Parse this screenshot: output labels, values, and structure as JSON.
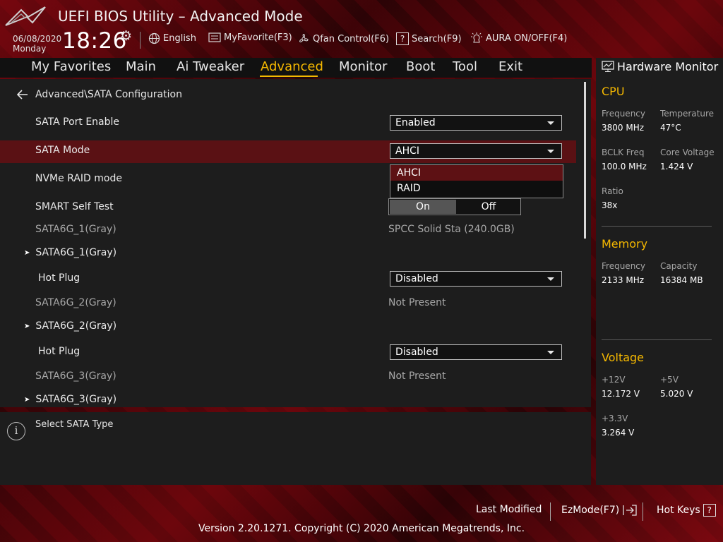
{
  "header": {
    "title": "UEFI BIOS Utility – Advanced Mode",
    "date": "06/08/2020",
    "day": "Monday",
    "time": "18:26",
    "tools": [
      {
        "label": "English",
        "icon": "globe-icon"
      },
      {
        "label": "MyFavorite(F3)",
        "icon": "favorite-list-icon"
      },
      {
        "label": "Qfan Control(F6)",
        "icon": "fan-icon"
      },
      {
        "label": "Search(F9)",
        "icon": "search-help-icon"
      },
      {
        "label": "AURA ON/OFF(F4)",
        "icon": "aura-light-icon"
      }
    ]
  },
  "nav": {
    "tabs": [
      "My Favorites",
      "Main",
      "Ai Tweaker",
      "Advanced",
      "Monitor",
      "Boot",
      "Tool",
      "Exit"
    ],
    "active": "Advanced"
  },
  "main": {
    "breadcrumb": "Advanced\\SATA Configuration",
    "rows": {
      "sata_port_enable": {
        "label": "SATA Port Enable",
        "value": "Enabled"
      },
      "sata_mode": {
        "label": "SATA Mode",
        "value": "AHCI",
        "options": [
          "AHCI",
          "RAID"
        ]
      },
      "nvme_raid": {
        "label": "NVMe RAID mode"
      },
      "smart": {
        "label": "SMART Self Test",
        "on": "On",
        "off": "Off",
        "selected": "On"
      },
      "port1_info": {
        "label": "SATA6G_1(Gray)",
        "value": "SPCC Solid Sta (240.0GB)"
      },
      "port1_sub": {
        "label": "SATA6G_1(Gray)"
      },
      "port1_hotplug": {
        "label": "Hot Plug",
        "value": "Disabled"
      },
      "port2_info": {
        "label": "SATA6G_2(Gray)",
        "value": "Not Present"
      },
      "port2_sub": {
        "label": "SATA6G_2(Gray)"
      },
      "port2_hotplug": {
        "label": "Hot Plug",
        "value": "Disabled"
      },
      "port3_info": {
        "label": "SATA6G_3(Gray)",
        "value": "Not Present"
      },
      "port3_sub": {
        "label": "SATA6G_3(Gray)"
      }
    }
  },
  "help": {
    "text": "Select SATA Type"
  },
  "hardware_monitor": {
    "title": "Hardware Monitor",
    "cpu": {
      "heading": "CPU",
      "frequency_label": "Frequency",
      "frequency": "3800 MHz",
      "temperature_label": "Temperature",
      "temperature": "47°C",
      "bclk_label": "BCLK Freq",
      "bclk": "100.0 MHz",
      "core_voltage_label": "Core Voltage",
      "core_voltage": "1.424 V",
      "ratio_label": "Ratio",
      "ratio": "38x"
    },
    "memory": {
      "heading": "Memory",
      "frequency_label": "Frequency",
      "frequency": "2133 MHz",
      "capacity_label": "Capacity",
      "capacity": "16384 MB"
    },
    "voltage": {
      "heading": "Voltage",
      "v12_label": "+12V",
      "v12": "12.172 V",
      "v5_label": "+5V",
      "v5": "5.020 V",
      "v33_label": "+3.3V",
      "v33": "3.264 V"
    }
  },
  "footer": {
    "last_modified": "Last Modified",
    "ezmode": "EzMode(F7)",
    "hotkeys": "Hot Keys",
    "version": "Version 2.20.1271. Copyright (C) 2020 American Megatrends, Inc."
  },
  "colors": {
    "accent": "#f5b800",
    "highlight_row": "#5a1114",
    "panel": "#1d1d1d"
  }
}
